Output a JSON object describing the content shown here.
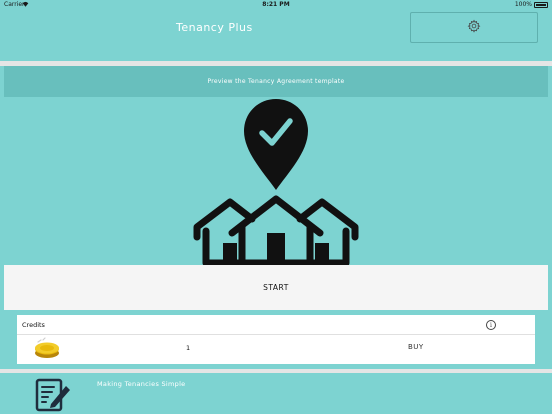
{
  "status_bar": {
    "carrier": "Carrier",
    "time": "8:21 PM",
    "battery": "100%"
  },
  "nav": {
    "title": "Tenancy Plus",
    "settings_icon": "gear-icon"
  },
  "card": {
    "preview_label": "Preview the Tenancy Agreement template",
    "hero_icon": "houses-location-check-icon",
    "start_label": "START"
  },
  "credits": {
    "label": "Credits",
    "info_icon": "info-icon",
    "coin_icon": "coin-icon",
    "count": "1",
    "buy_label": "BUY"
  },
  "footer": {
    "logo_icon": "document-pencil-icon",
    "tagline": "Making Tenancies Simple"
  },
  "colors": {
    "teal": "#7dd3d1",
    "teal_dark": "#68bfbd",
    "white": "#ffffff",
    "coin": "#e8b90c"
  }
}
